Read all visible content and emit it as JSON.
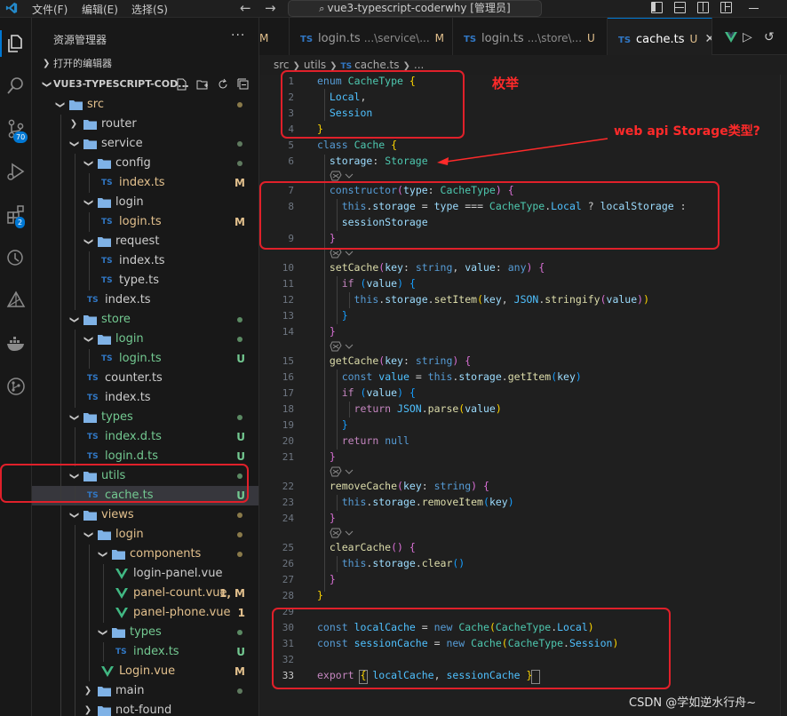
{
  "titlebar": {
    "menu": [
      "文件(F)",
      "编辑(E)",
      "选择(S)"
    ],
    "search_text": "vue3-typescript-coderwhy [管理员]"
  },
  "activity": {
    "scm_badge": "70",
    "extensions_badge": "2"
  },
  "sidebar": {
    "title": "资源管理器",
    "more": "···",
    "open_editors": "打开的编辑器",
    "project": "VUE3-TYPESCRIPT-COD...",
    "tree": [
      {
        "name": "src",
        "kind": "folder",
        "open": true,
        "depth": 0,
        "status": "dot",
        "color": "yellow"
      },
      {
        "name": "router",
        "kind": "folder",
        "open": false,
        "depth": 1,
        "status": "",
        "color": ""
      },
      {
        "name": "service",
        "kind": "folder",
        "open": true,
        "depth": 1,
        "status": "dot",
        "color": ""
      },
      {
        "name": "config",
        "kind": "folder",
        "open": true,
        "depth": 2,
        "status": "dot",
        "color": ""
      },
      {
        "name": "index.ts",
        "kind": "ts",
        "depth": 3,
        "status": "M",
        "color": "yellow"
      },
      {
        "name": "login",
        "kind": "folder",
        "open": true,
        "depth": 2,
        "status": "",
        "color": ""
      },
      {
        "name": "login.ts",
        "kind": "ts",
        "depth": 3,
        "status": "M",
        "color": "yellow"
      },
      {
        "name": "request",
        "kind": "folder",
        "open": true,
        "depth": 2,
        "status": "",
        "color": ""
      },
      {
        "name": "index.ts",
        "kind": "ts",
        "depth": 3,
        "status": "",
        "color": ""
      },
      {
        "name": "type.ts",
        "kind": "ts",
        "depth": 3,
        "status": "",
        "color": ""
      },
      {
        "name": "index.ts",
        "kind": "ts",
        "depth": 2,
        "status": "",
        "color": ""
      },
      {
        "name": "store",
        "kind": "folder",
        "open": true,
        "depth": 1,
        "status": "dot",
        "color": "green"
      },
      {
        "name": "login",
        "kind": "folder",
        "open": true,
        "depth": 2,
        "status": "dot",
        "color": "green"
      },
      {
        "name": "login.ts",
        "kind": "ts",
        "depth": 3,
        "status": "U",
        "color": "green"
      },
      {
        "name": "counter.ts",
        "kind": "ts",
        "depth": 2,
        "status": "",
        "color": ""
      },
      {
        "name": "index.ts",
        "kind": "ts",
        "depth": 2,
        "status": "",
        "color": ""
      },
      {
        "name": "types",
        "kind": "folder",
        "open": true,
        "depth": 1,
        "status": "dot",
        "color": "green"
      },
      {
        "name": "index.d.ts",
        "kind": "ts",
        "depth": 2,
        "status": "U",
        "color": "green"
      },
      {
        "name": "login.d.ts",
        "kind": "ts",
        "depth": 2,
        "status": "U",
        "color": "green"
      },
      {
        "name": "utils",
        "kind": "folder",
        "open": true,
        "depth": 1,
        "status": "dot",
        "color": "green"
      },
      {
        "name": "cache.ts",
        "kind": "ts",
        "depth": 2,
        "status": "U",
        "color": "green",
        "selected": true
      },
      {
        "name": "views",
        "kind": "folder",
        "open": true,
        "depth": 1,
        "status": "dot",
        "color": "yellow"
      },
      {
        "name": "login",
        "kind": "folder",
        "open": true,
        "depth": 2,
        "status": "dot",
        "color": "yellow"
      },
      {
        "name": "components",
        "kind": "folder",
        "open": true,
        "depth": 3,
        "status": "dot",
        "color": "yellow"
      },
      {
        "name": "login-panel.vue",
        "kind": "vue",
        "depth": 4,
        "status": "",
        "color": ""
      },
      {
        "name": "panel-count.vue",
        "kind": "vue",
        "depth": 4,
        "status": "1, M",
        "color": "yellow"
      },
      {
        "name": "panel-phone.vue",
        "kind": "vue",
        "depth": 4,
        "status": "1",
        "color": "yellow"
      },
      {
        "name": "types",
        "kind": "folder",
        "open": true,
        "depth": 3,
        "status": "dot",
        "color": "green"
      },
      {
        "name": "index.ts",
        "kind": "ts",
        "depth": 4,
        "status": "U",
        "color": "green"
      },
      {
        "name": "Login.vue",
        "kind": "vue",
        "depth": 3,
        "status": "M",
        "color": "yellow"
      },
      {
        "name": "main",
        "kind": "folder",
        "open": false,
        "depth": 2,
        "status": "dot",
        "color": ""
      },
      {
        "name": "not-found",
        "kind": "folder",
        "open": false,
        "depth": 2,
        "status": "",
        "color": ""
      }
    ]
  },
  "tabs": [
    {
      "lead": "M",
      "name": "",
      "path": "",
      "mod": ""
    },
    {
      "name": "login.ts",
      "path": "...\\service\\...",
      "mod": "M"
    },
    {
      "name": "login.ts",
      "path": "...\\store\\...",
      "mod": "U"
    },
    {
      "name": "cache.ts",
      "path": "",
      "mod": "U",
      "active": true
    }
  ],
  "breadcrumbs": [
    "src",
    "utils",
    "cache.ts",
    "..."
  ],
  "editor": {
    "line_numbers": [
      "1",
      "2",
      "3",
      "4",
      "5",
      "6",
      "",
      "7",
      "8",
      "",
      "9",
      "",
      "10",
      "11",
      "12",
      "13",
      "14",
      "",
      "15",
      "16",
      "17",
      "18",
      "19",
      "20",
      "21",
      "",
      "22",
      "23",
      "24",
      "",
      "25",
      "26",
      "27",
      "28",
      "29",
      "30",
      "31",
      "32",
      "33"
    ],
    "current_line": "33"
  },
  "annotations": {
    "enum_note": "枚举",
    "storage_note": "web api Storage类型?"
  },
  "watermark": "CSDN @学如逆水行舟~"
}
